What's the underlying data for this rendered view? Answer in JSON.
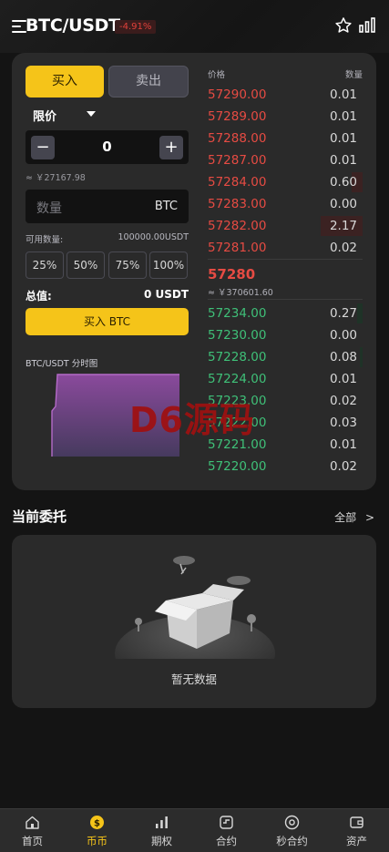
{
  "header": {
    "title": "BTC/USDT",
    "change": "-4.91%"
  },
  "trade": {
    "buy_tab": "买入",
    "sell_tab": "卖出",
    "order_type": "限价",
    "price_value": "0",
    "minus": "−",
    "plus": "+",
    "approx_price": "≈ ￥27167.98",
    "qty_placeholder": "数量",
    "qty_unit": "BTC",
    "available_label": "可用数量:",
    "available_value": "100000.00USDT",
    "percents": [
      "25%",
      "50%",
      "75%",
      "100%"
    ],
    "total_label": "总值:",
    "total_value": "0 USDT",
    "submit_label": "买入 BTC",
    "mini_chart_title": "BTC/USDT 分时图"
  },
  "orderbook": {
    "price_header": "价格",
    "qty_header": "数量",
    "asks": [
      {
        "price": "57290.00",
        "qty": "0.01",
        "depth": 0
      },
      {
        "price": "57289.00",
        "qty": "0.01",
        "depth": 0
      },
      {
        "price": "57288.00",
        "qty": "0.01",
        "depth": 0
      },
      {
        "price": "57287.00",
        "qty": "0.01",
        "depth": 0
      },
      {
        "price": "57284.00",
        "qty": "0.60",
        "depth": 0.27
      },
      {
        "price": "57283.00",
        "qty": "0.00",
        "depth": 0
      },
      {
        "price": "57282.00",
        "qty": "2.17",
        "depth": 1.0
      },
      {
        "price": "57281.00",
        "qty": "0.02",
        "depth": 0
      }
    ],
    "last_price": "57280",
    "last_price_cny": "≈ ￥370601.60",
    "bids": [
      {
        "price": "57234.00",
        "qty": "0.27",
        "depth": 0.12
      },
      {
        "price": "57230.00",
        "qty": "0.00",
        "depth": 0
      },
      {
        "price": "57228.00",
        "qty": "0.08",
        "depth": 0.06
      },
      {
        "price": "57224.00",
        "qty": "0.01",
        "depth": 0
      },
      {
        "price": "57223.00",
        "qty": "0.02",
        "depth": 0.01
      },
      {
        "price": "57222.00",
        "qty": "0.03",
        "depth": 0.01
      },
      {
        "price": "57221.00",
        "qty": "0.01",
        "depth": 0
      },
      {
        "price": "57220.00",
        "qty": "0.02",
        "depth": 0
      }
    ]
  },
  "watermark": "D6源码",
  "orders": {
    "title": "当前委托",
    "all_link": "全部",
    "all_arrow": ">",
    "empty_text": "暂无数据"
  },
  "tabbar": {
    "items": [
      {
        "label": "首页",
        "icon": "home-icon"
      },
      {
        "label": "币币",
        "icon": "coin-icon",
        "active": true
      },
      {
        "label": "期权",
        "icon": "options-icon"
      },
      {
        "label": "合约",
        "icon": "contract-icon"
      },
      {
        "label": "秒合约",
        "icon": "second-contract-icon"
      },
      {
        "label": "资产",
        "icon": "wallet-icon"
      }
    ]
  },
  "colors": {
    "accent": "#f5c419",
    "ask": "#e64b43",
    "bid": "#3fc078",
    "card": "#2a2a2a",
    "background": "#141414"
  }
}
